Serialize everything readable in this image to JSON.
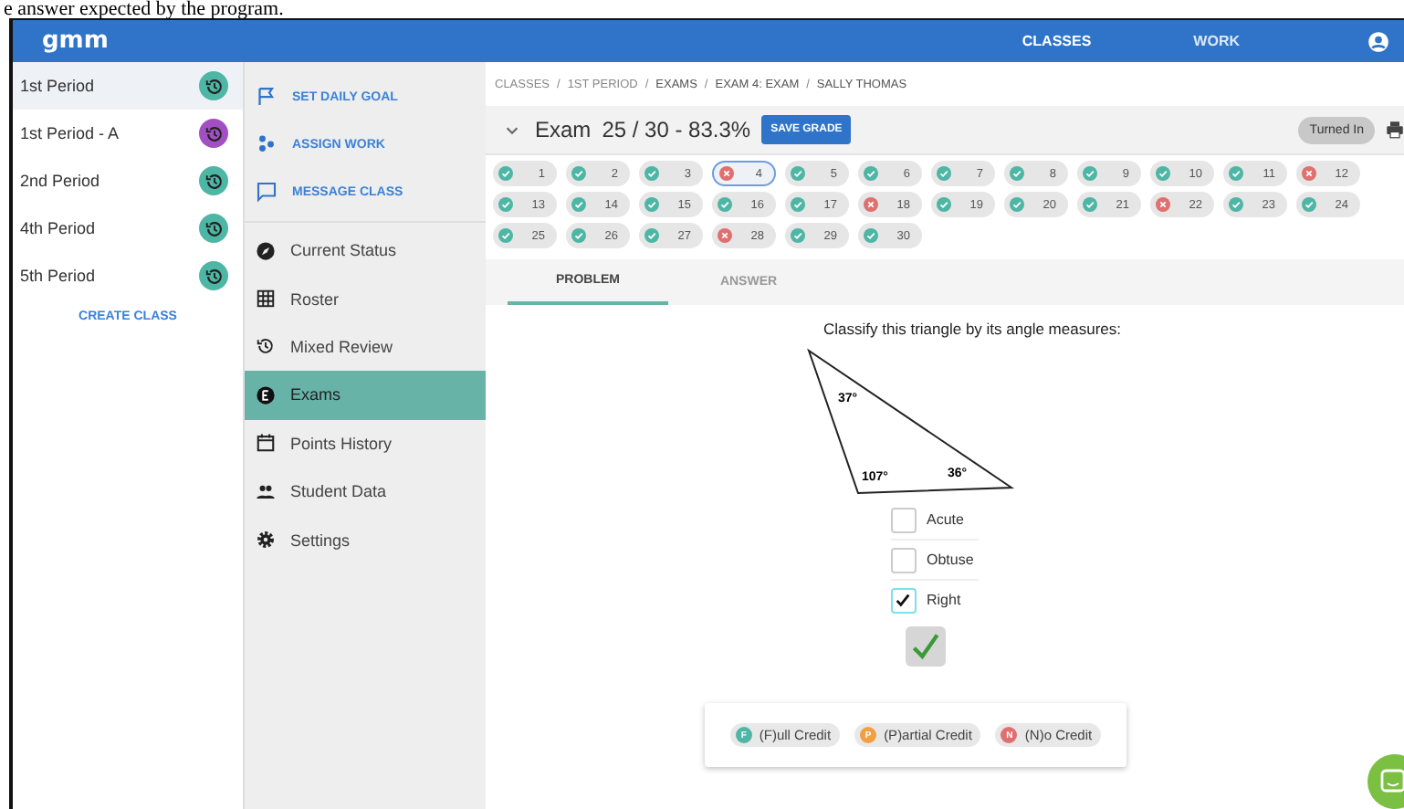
{
  "caption": "e answer expected by the program.",
  "header": {
    "logo": "gmm",
    "nav": [
      {
        "label": "CLASSES",
        "selected": true
      },
      {
        "label": "WORK",
        "selected": false
      }
    ]
  },
  "classes": [
    {
      "name": "1st Period",
      "selected": true,
      "color": "#4db6a4"
    },
    {
      "name": "1st Period - A",
      "selected": false,
      "color": "#a34fc4"
    },
    {
      "name": "2nd Period",
      "selected": false,
      "color": "#4db6a4"
    },
    {
      "name": "4th Period",
      "selected": false,
      "color": "#4db6a4"
    },
    {
      "name": "5th Period",
      "selected": false,
      "color": "#4db6a4"
    }
  ],
  "create_class": "CREATE CLASS",
  "actions": [
    {
      "kind": "flag",
      "label": "SET DAILY GOAL"
    },
    {
      "kind": "assign",
      "label": "ASSIGN WORK"
    },
    {
      "kind": "message",
      "label": "MESSAGE CLASS"
    }
  ],
  "menu": [
    {
      "kind": "compass",
      "label": "Current Status",
      "selected": false
    },
    {
      "kind": "grid",
      "label": "Roster",
      "selected": false
    },
    {
      "kind": "history",
      "label": "Mixed Review",
      "selected": false
    },
    {
      "kind": "exam",
      "label": "Exams",
      "selected": true
    },
    {
      "kind": "calendar",
      "label": "Points History",
      "selected": false
    },
    {
      "kind": "people",
      "label": "Student Data",
      "selected": false
    },
    {
      "kind": "gear",
      "label": "Settings",
      "selected": false
    }
  ],
  "breadcrumb": [
    "CLASSES",
    "1ST PERIOD",
    "EXAMS",
    "EXAM 4: EXAM",
    "SALLY THOMAS"
  ],
  "breadcrumb_separator": "/",
  "exam": {
    "title": "Exam",
    "score": "25 / 30 - 83.3%",
    "save": "SAVE GRADE",
    "status": "Turned In"
  },
  "questions": [
    {
      "number": "1",
      "correct": true,
      "selected": false
    },
    {
      "number": "2",
      "correct": true,
      "selected": false
    },
    {
      "number": "3",
      "correct": true,
      "selected": false
    },
    {
      "number": "4",
      "correct": false,
      "selected": true
    },
    {
      "number": "5",
      "correct": true,
      "selected": false
    },
    {
      "number": "6",
      "correct": true,
      "selected": false
    },
    {
      "number": "7",
      "correct": true,
      "selected": false
    },
    {
      "number": "8",
      "correct": true,
      "selected": false
    },
    {
      "number": "9",
      "correct": true,
      "selected": false
    },
    {
      "number": "10",
      "correct": true,
      "selected": false
    },
    {
      "number": "11",
      "correct": true,
      "selected": false
    },
    {
      "number": "12",
      "correct": false,
      "selected": false
    },
    {
      "number": "13",
      "correct": true,
      "selected": false
    },
    {
      "number": "14",
      "correct": true,
      "selected": false
    },
    {
      "number": "15",
      "correct": true,
      "selected": false
    },
    {
      "number": "16",
      "correct": true,
      "selected": false
    },
    {
      "number": "17",
      "correct": true,
      "selected": false
    },
    {
      "number": "18",
      "correct": false,
      "selected": false
    },
    {
      "number": "19",
      "correct": true,
      "selected": false
    },
    {
      "number": "20",
      "correct": true,
      "selected": false
    },
    {
      "number": "21",
      "correct": true,
      "selected": false
    },
    {
      "number": "22",
      "correct": false,
      "selected": false
    },
    {
      "number": "23",
      "correct": true,
      "selected": false
    },
    {
      "number": "24",
      "correct": true,
      "selected": false
    },
    {
      "number": "25",
      "correct": true,
      "selected": false
    },
    {
      "number": "26",
      "correct": true,
      "selected": false
    },
    {
      "number": "27",
      "correct": true,
      "selected": false
    },
    {
      "number": "28",
      "correct": false,
      "selected": false
    },
    {
      "number": "29",
      "correct": true,
      "selected": false
    },
    {
      "number": "30",
      "correct": true,
      "selected": false
    }
  ],
  "tabs": [
    {
      "label": "PROBLEM",
      "selected": true
    },
    {
      "label": "ANSWER",
      "selected": false
    }
  ],
  "problem": {
    "prompt": "Classify this triangle by its angle measures:",
    "angles": [
      "37°",
      "107°",
      "36°"
    ],
    "options": [
      {
        "label": "Acute",
        "checked": false
      },
      {
        "label": "Obtuse",
        "checked": false
      },
      {
        "label": "Right",
        "checked": true
      }
    ],
    "result_correct": true
  },
  "legend": [
    {
      "letter": "F",
      "label": "(F)ull Credit",
      "color": "#4db6a4"
    },
    {
      "letter": "P",
      "label": "(P)artial Credit",
      "color": "#f0a040"
    },
    {
      "letter": "N",
      "label": "(N)o Credit",
      "color": "#e07070"
    }
  ]
}
